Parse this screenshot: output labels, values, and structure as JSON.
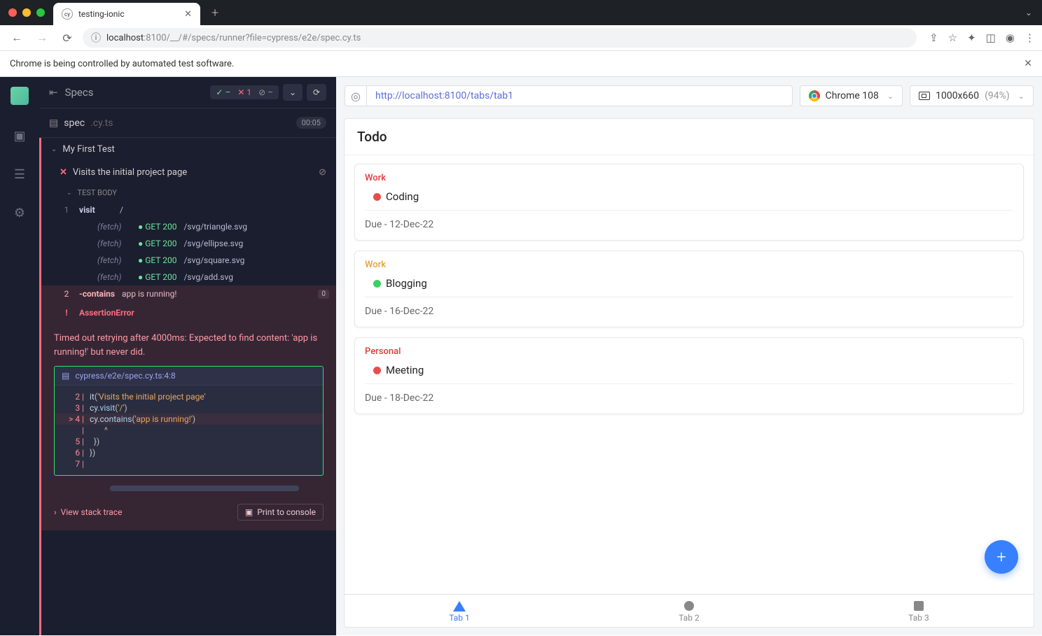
{
  "browser": {
    "tab_title": "testing-ionic",
    "url_host": "localhost",
    "url_port": ":8100",
    "url_path": "/__/#/specs/runner?file=cypress/e2e/spec.cy.ts",
    "automation_message": "Chrome is being controlled by automated test software."
  },
  "cypress": {
    "specs_label": "Specs",
    "stats": {
      "pass": "–",
      "fail_count": "1",
      "pending": "–"
    },
    "spec_file": {
      "name": "spec",
      "ext": ".cy.ts",
      "time": "00:05"
    },
    "suite": "My First Test",
    "test_name": "Visits the initial project page",
    "test_body_label": "TEST BODY",
    "log": {
      "visit_num": "1",
      "visit_cmd": "visit",
      "visit_arg": "/",
      "fetch_label": "(fetch)",
      "get200": "GET 200",
      "f1": "/svg/triangle.svg",
      "f2": "/svg/ellipse.svg",
      "f3": "/svg/square.svg",
      "f4": "/svg/add.svg",
      "fail_num": "2",
      "fail_cmd": "-contains",
      "fail_arg": "app is running!",
      "fail_badge": "0"
    },
    "error": {
      "type": "AssertionError",
      "message": "Timed out retrying after 4000ms: Expected to find content: 'app is running!' but never did.",
      "file_loc": "cypress/e2e/spec.cy.ts:4:8",
      "line2_gutter": "2 |",
      "line2_a": "it",
      "line2_b": "(",
      "line2_c": "'Visits the initial project page'",
      "line3_gutter": "3 |",
      "line3_a": "cy.",
      "line3_b": "visit",
      "line3_c": "(",
      "line3_d": "'/'",
      "line3_e": ")",
      "line4_gutter": "> 4 |",
      "line4_a": "cy.",
      "line4_b": "contains",
      "line4_c": "(",
      "line4_d": "'app is running!'",
      "line4_e": ")",
      "caret_gutter": "   |",
      "caret": "       ^",
      "line5_gutter": "5 |",
      "line5": "  })",
      "line6_gutter": "6 |",
      "line6": "})",
      "line7_gutter": "7 |",
      "stack_trace": "View stack trace",
      "print_console": "Print to console"
    }
  },
  "preview": {
    "url": "http://localhost:8100/tabs/tab1",
    "browser_name": "Chrome 108",
    "dimensions": "1000x660",
    "scale": "(94%)"
  },
  "app": {
    "title": "Todo",
    "todos": [
      {
        "category": "Work",
        "cat_class": "cat-red",
        "dot_class": "dot-red",
        "title": "Coding",
        "due": "Due - 12-Dec-22"
      },
      {
        "category": "Work",
        "cat_class": "cat-orange",
        "dot_class": "dot-green",
        "title": "Blogging",
        "due": "Due - 16-Dec-22"
      },
      {
        "category": "Personal",
        "cat_class": "cat-red",
        "dot_class": "dot-red",
        "title": "Meeting",
        "due": "Due - 18-Dec-22"
      }
    ],
    "tabs": [
      {
        "label": "Tab 1"
      },
      {
        "label": "Tab 2"
      },
      {
        "label": "Tab 3"
      }
    ]
  }
}
